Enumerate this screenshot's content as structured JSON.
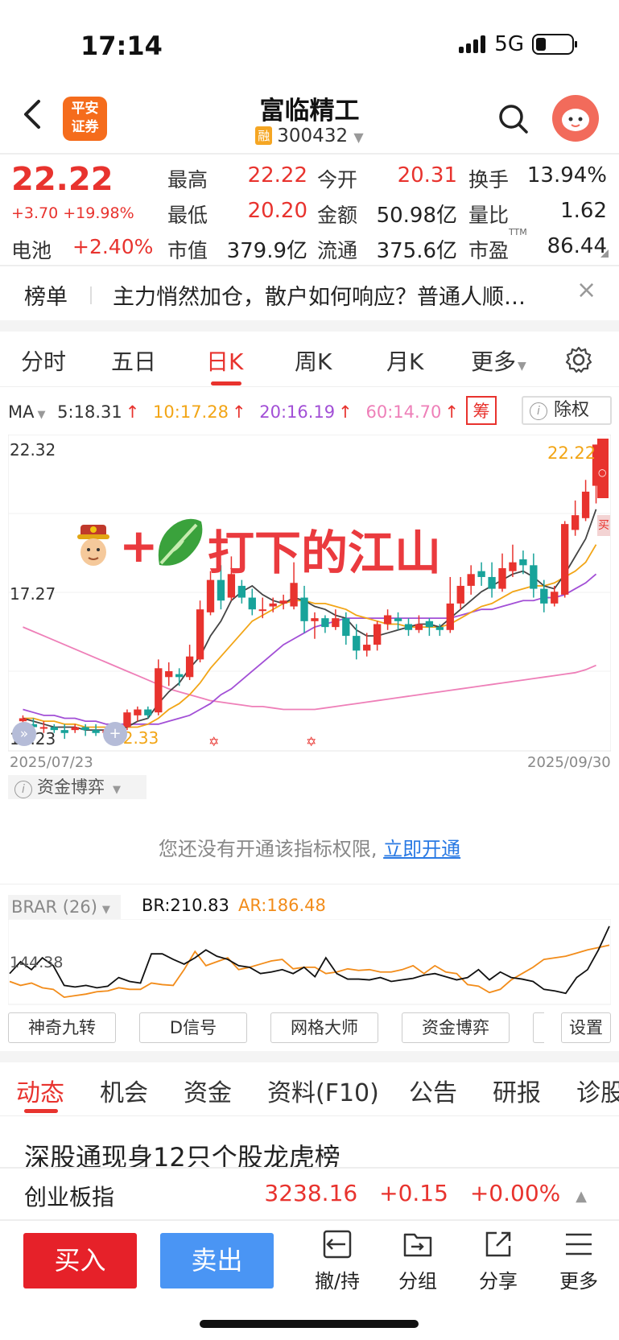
{
  "status": {
    "time": "17:14",
    "network": "5G"
  },
  "header": {
    "brand": "平安证券",
    "brand_line1": "平安",
    "brand_line2": "证券",
    "stock_name": "富临精工",
    "rong": "融",
    "stock_code": "300432"
  },
  "quote": {
    "price": "22.22",
    "change": "+3.70 +19.98%",
    "sector_label": "电池",
    "sector_change": "+2.40%",
    "fields": [
      {
        "label": "最高",
        "value": "22.22",
        "color": "red"
      },
      {
        "label": "今开",
        "value": "20.31",
        "color": "red"
      },
      {
        "label": "换手",
        "value": "13.94%",
        "color": "black"
      },
      {
        "label": "最低",
        "value": "20.20",
        "color": "red"
      },
      {
        "label": "金额",
        "value": "50.98亿",
        "color": "black"
      },
      {
        "label": "量比",
        "value": "1.62",
        "color": "black"
      },
      {
        "label": "市值",
        "value": "379.9亿",
        "color": "black"
      },
      {
        "label": "流通",
        "value": "375.6亿",
        "color": "black"
      },
      {
        "label": "市盈",
        "value": "86.44",
        "color": "black",
        "sup": "TTM"
      }
    ]
  },
  "news": {
    "tag": "榜单",
    "text": "主力悄然加仓，散户如何响应？普通人顺…",
    "close": "×"
  },
  "tabs": [
    {
      "label": "分时"
    },
    {
      "label": "五日"
    },
    {
      "label": "日K",
      "active": true
    },
    {
      "label": "周K"
    },
    {
      "label": "月K"
    },
    {
      "label": "更多"
    }
  ],
  "ma": {
    "label": "MA",
    "items": [
      {
        "text": "5:18.31",
        "color": "#333333"
      },
      {
        "text": "10:17.28",
        "color": "#f2a516"
      },
      {
        "text": "20:16.19",
        "color": "#a24fd6"
      },
      {
        "text": "60:14.70",
        "color": "#ee7fb8"
      }
    ],
    "arrow": "↑",
    "chou": "筹",
    "chuquan": "除权"
  },
  "kchart": {
    "y_high": "22.32",
    "y_mid": "17.27",
    "y_low": "12.23",
    "low_marker": "12.33",
    "last_price": "22.22",
    "date_start": "2025/07/23",
    "date_end": "2025/09/30",
    "overlay_text": "打下的江山",
    "overlay_plus": "+",
    "side_label": "买",
    "side_o": "○",
    "candles": [
      [
        12.8,
        12.9,
        12.6,
        13.0
      ],
      [
        12.7,
        12.6,
        12.5,
        12.9
      ],
      [
        12.6,
        12.6,
        12.4,
        12.8
      ],
      [
        12.6,
        12.5,
        12.4,
        12.7
      ],
      [
        12.5,
        12.4,
        12.2,
        12.7
      ],
      [
        12.5,
        12.6,
        12.4,
        12.7
      ],
      [
        12.6,
        12.5,
        12.3,
        12.7
      ],
      [
        12.5,
        12.4,
        12.3,
        12.7
      ],
      [
        12.4,
        12.5,
        12.3,
        12.6
      ],
      [
        12.5,
        12.5,
        12.3,
        12.7
      ],
      [
        12.6,
        13.1,
        12.5,
        13.2
      ],
      [
        13.0,
        13.2,
        12.8,
        13.3
      ],
      [
        13.2,
        13.0,
        12.9,
        13.3
      ],
      [
        13.1,
        14.6,
        13.0,
        14.9
      ],
      [
        14.3,
        14.5,
        14.0,
        14.8
      ],
      [
        14.4,
        14.3,
        14.0,
        14.6
      ],
      [
        14.3,
        15.0,
        14.2,
        15.4
      ],
      [
        14.9,
        16.6,
        14.8,
        16.9
      ],
      [
        16.5,
        17.6,
        16.4,
        17.9
      ],
      [
        17.6,
        16.9,
        16.6,
        18.1
      ],
      [
        17.0,
        17.8,
        16.9,
        18.4
      ],
      [
        17.4,
        17.0,
        16.8,
        17.6
      ],
      [
        17.0,
        16.6,
        16.4,
        17.3
      ],
      [
        16.6,
        16.6,
        16.3,
        17.0
      ],
      [
        16.7,
        16.8,
        16.5,
        17.0
      ],
      [
        16.8,
        16.9,
        16.6,
        17.1
      ],
      [
        16.7,
        17.5,
        16.6,
        18.2
      ],
      [
        17.0,
        16.2,
        15.8,
        17.4
      ],
      [
        16.2,
        16.3,
        15.6,
        16.5
      ],
      [
        16.3,
        16.0,
        15.8,
        16.4
      ],
      [
        16.0,
        16.3,
        15.9,
        16.6
      ],
      [
        16.3,
        15.7,
        15.4,
        16.5
      ],
      [
        15.7,
        15.2,
        14.9,
        16.1
      ],
      [
        15.2,
        15.4,
        15.0,
        15.8
      ],
      [
        15.4,
        16.1,
        15.2,
        16.2
      ],
      [
        16.1,
        16.4,
        15.9,
        16.6
      ],
      [
        16.3,
        16.2,
        15.9,
        16.5
      ],
      [
        16.1,
        15.9,
        15.7,
        16.3
      ],
      [
        15.9,
        16.1,
        15.8,
        16.4
      ],
      [
        16.2,
        16.0,
        15.7,
        16.3
      ],
      [
        16.0,
        15.9,
        15.7,
        16.1
      ],
      [
        15.9,
        16.8,
        15.8,
        17.7
      ],
      [
        16.8,
        17.4,
        16.6,
        17.7
      ],
      [
        17.4,
        17.8,
        17.1,
        18.1
      ],
      [
        17.9,
        17.7,
        17.4,
        18.2
      ],
      [
        17.7,
        17.3,
        17.0,
        18.2
      ],
      [
        17.3,
        18.0,
        17.2,
        18.5
      ],
      [
        17.9,
        18.2,
        17.7,
        18.8
      ],
      [
        18.3,
        18.1,
        17.8,
        18.6
      ],
      [
        18.1,
        17.3,
        17.0,
        18.5
      ],
      [
        17.3,
        16.8,
        16.5,
        17.6
      ],
      [
        16.8,
        17.2,
        16.7,
        17.4
      ],
      [
        17.1,
        19.5,
        17.0,
        19.6
      ],
      [
        19.3,
        19.8,
        19.1,
        20.3
      ],
      [
        19.7,
        20.6,
        19.6,
        21.0
      ],
      [
        20.8,
        22.2,
        20.2,
        22.2
      ]
    ],
    "ma5": [
      12.9,
      12.8,
      12.7,
      12.6,
      12.6,
      12.6,
      12.5,
      12.5,
      12.5,
      12.5,
      12.6,
      12.8,
      12.9,
      13.4,
      13.8,
      14.1,
      14.6,
      15.0,
      15.7,
      16.2,
      16.9,
      17.2,
      17.4,
      17.1,
      16.9,
      16.8,
      17.0,
      16.9,
      16.7,
      16.6,
      16.4,
      16.3,
      15.9,
      15.7,
      15.7,
      15.8,
      15.9,
      16.0,
      16.1,
      16.1,
      16.0,
      16.3,
      16.6,
      16.9,
      17.2,
      17.4,
      17.6,
      17.8,
      17.9,
      17.7,
      17.4,
      17.3,
      17.8,
      18.4,
      19.0,
      20.0
    ],
    "ma10": [
      12.9,
      12.9,
      12.8,
      12.8,
      12.7,
      12.7,
      12.6,
      12.6,
      12.6,
      12.5,
      12.6,
      12.6,
      12.7,
      12.9,
      13.2,
      13.4,
      13.7,
      14.1,
      14.6,
      15.0,
      15.4,
      15.8,
      16.2,
      16.4,
      16.6,
      16.8,
      16.9,
      16.9,
      16.8,
      16.8,
      16.7,
      16.6,
      16.4,
      16.3,
      16.2,
      16.1,
      16.1,
      16.0,
      16.0,
      16.0,
      16.0,
      16.1,
      16.3,
      16.5,
      16.7,
      16.8,
      17.0,
      17.2,
      17.3,
      17.4,
      17.4,
      17.5,
      17.7,
      17.9,
      18.2,
      18.8
    ],
    "ma20": [
      13.2,
      13.1,
      13.0,
      13.0,
      12.9,
      12.9,
      12.8,
      12.8,
      12.7,
      12.7,
      12.7,
      12.7,
      12.7,
      12.7,
      12.8,
      12.9,
      13.0,
      13.2,
      13.4,
      13.7,
      13.9,
      14.2,
      14.5,
      14.8,
      15.1,
      15.4,
      15.6,
      15.8,
      16.0,
      16.1,
      16.2,
      16.3,
      16.3,
      16.3,
      16.3,
      16.3,
      16.3,
      16.3,
      16.3,
      16.3,
      16.3,
      16.3,
      16.4,
      16.5,
      16.6,
      16.6,
      16.7,
      16.8,
      16.9,
      16.9,
      17.0,
      17.0,
      17.1,
      17.3,
      17.5,
      17.8
    ],
    "ma60": [
      16.0,
      15.85,
      15.7,
      15.55,
      15.4,
      15.25,
      15.1,
      14.95,
      14.8,
      14.65,
      14.5,
      14.35,
      14.2,
      14.05,
      13.9,
      13.8,
      13.7,
      13.6,
      13.5,
      13.45,
      13.4,
      13.35,
      13.3,
      13.3,
      13.25,
      13.2,
      13.2,
      13.2,
      13.2,
      13.25,
      13.3,
      13.35,
      13.4,
      13.45,
      13.5,
      13.55,
      13.6,
      13.65,
      13.7,
      13.75,
      13.8,
      13.85,
      13.9,
      13.95,
      14.0,
      14.05,
      14.1,
      14.15,
      14.2,
      14.25,
      14.3,
      14.35,
      14.4,
      14.45,
      14.55,
      14.7
    ]
  },
  "zijin": {
    "label": "资金博弈",
    "msg": "您还没有开通该指标权限,",
    "link": "立即开通"
  },
  "brar": {
    "label": "BRAR (26)",
    "br_text": "BR:210.83",
    "ar_text": "AR:186.48",
    "axis_label": "144.38",
    "br": [
      150,
      165,
      155,
      170,
      160,
      135,
      133,
      135,
      132,
      134,
      145,
      140,
      138,
      175,
      175,
      168,
      162,
      170,
      180,
      172,
      168,
      160,
      158,
      150,
      152,
      155,
      150,
      158,
      146,
      170,
      150,
      143,
      143,
      142,
      145,
      140,
      142,
      144,
      148,
      150,
      146,
      142,
      145,
      155,
      142,
      152,
      145,
      143,
      140,
      130,
      128,
      125,
      145,
      155,
      180,
      210
    ],
    "ar": [
      140,
      135,
      138,
      132,
      130,
      120,
      122,
      124,
      127,
      128,
      132,
      130,
      130,
      138,
      136,
      135,
      155,
      178,
      160,
      165,
      170,
      155,
      158,
      162,
      166,
      168,
      156,
      158,
      158,
      150,
      152,
      156,
      154,
      155,
      152,
      152,
      155,
      160,
      150,
      160,
      152,
      150,
      136,
      134,
      126,
      130,
      142,
      150,
      158,
      168,
      170,
      172,
      176,
      180,
      183,
      186
    ]
  },
  "indicators": [
    "神奇九转",
    "D信号",
    "网格大师",
    "资金博弈",
    "设置"
  ],
  "sub_tabs": [
    "动态",
    "机会",
    "资金",
    "资料(F10)",
    "公告",
    "研报",
    "诊股"
  ],
  "headline": "深股通现身12只个股龙虎榜",
  "index_bar": {
    "name": "创业板指",
    "value": "3238.16",
    "change": "+0.15",
    "pct": "+0.00%"
  },
  "bottom": {
    "buy": "买入",
    "sell": "卖出",
    "tools": [
      "撤/持",
      "分组",
      "分享",
      "更多"
    ]
  }
}
